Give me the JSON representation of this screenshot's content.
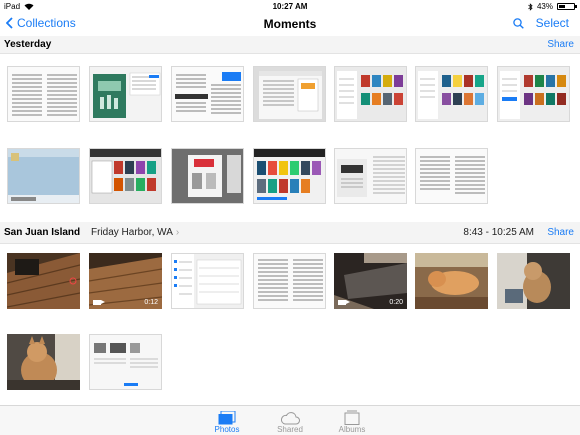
{
  "status_bar": {
    "device": "iPad",
    "time": "10:27 AM",
    "battery": "43%",
    "battery_level": 0.43
  },
  "nav": {
    "back_label": "Collections",
    "title": "Moments",
    "select_label": "Select"
  },
  "sections": [
    {
      "title": "Yesterday",
      "share_label": "Share"
    },
    {
      "title": "San Juan Island",
      "location": "Friday Harbor, WA",
      "time_range": "8:43 - 10:25 AM",
      "share_label": "Share"
    }
  ],
  "videos": [
    {
      "duration": "0:12"
    },
    {
      "duration": "0:20"
    }
  ],
  "tabs": [
    {
      "label": "Photos"
    },
    {
      "label": "Shared"
    },
    {
      "label": "Albums"
    }
  ],
  "colors": {
    "accent": "#1a7cf5",
    "header_bg": "#f4f4f4"
  }
}
